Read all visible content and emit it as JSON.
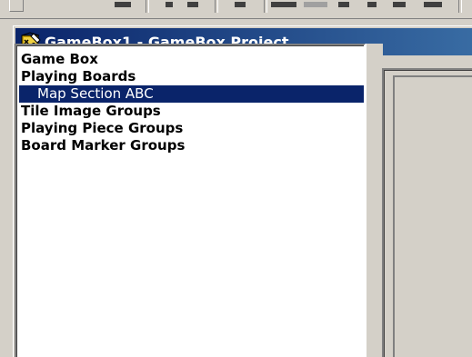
{
  "window": {
    "title": "GameBox1 - GameBox Project"
  },
  "tree": {
    "items": [
      {
        "label": "Game Box",
        "level": 0,
        "selected": false
      },
      {
        "label": "Playing Boards",
        "level": 0,
        "selected": false
      },
      {
        "label": "Map Section ABC",
        "level": 1,
        "selected": true
      },
      {
        "label": "Tile Image Groups",
        "level": 0,
        "selected": false
      },
      {
        "label": "Playing Piece Groups",
        "level": 0,
        "selected": false
      },
      {
        "label": "Board Marker Groups",
        "level": 0,
        "selected": false
      }
    ]
  },
  "colors": {
    "titlebar_start": "#0a246a",
    "titlebar_end": "#3a6ea5",
    "selection": "#0a246a",
    "face": "#d4d0c8"
  },
  "icons": {
    "title": "gamebox-project-icon"
  }
}
